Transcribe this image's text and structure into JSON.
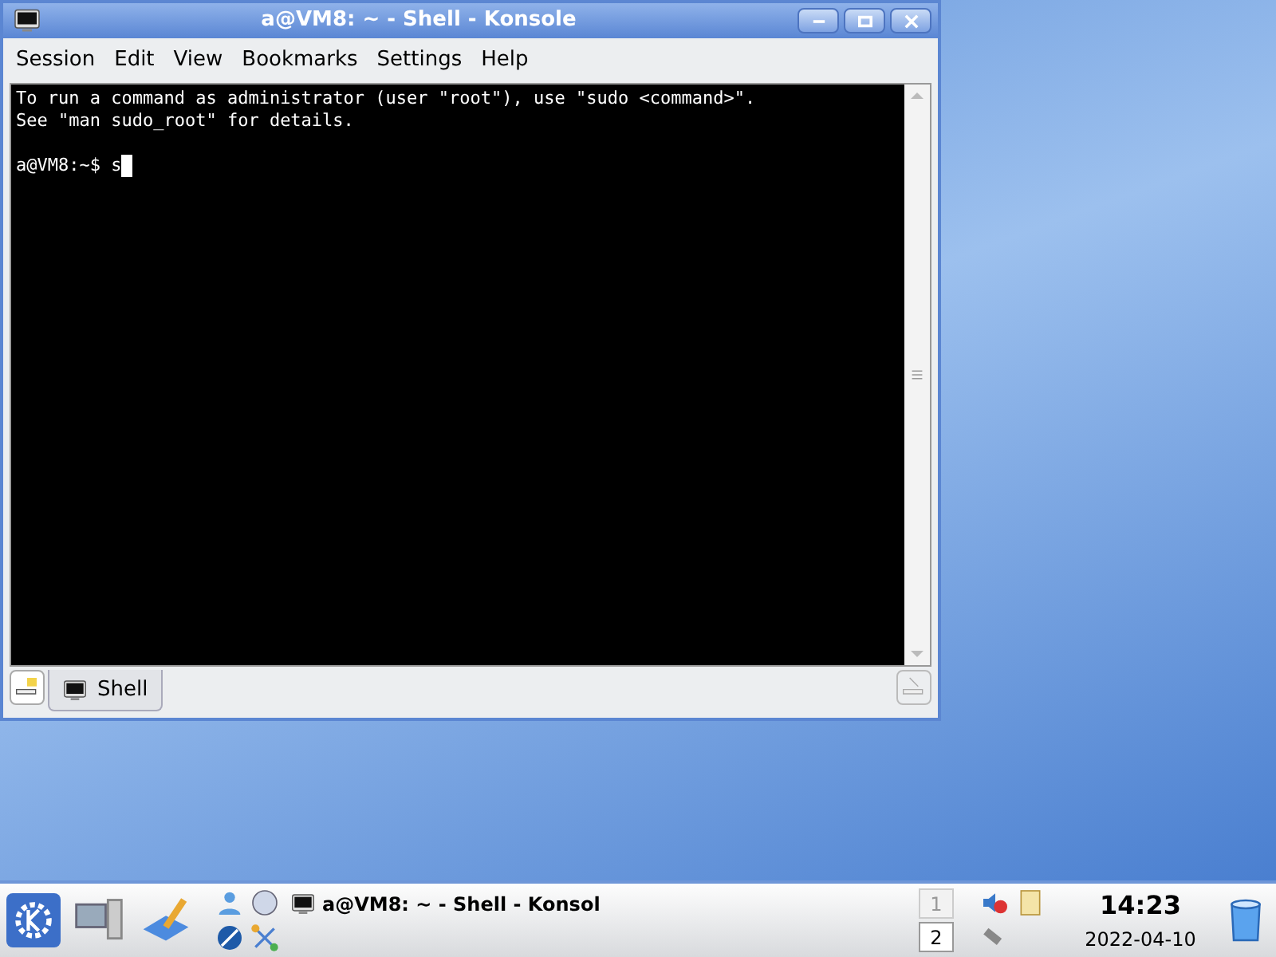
{
  "window": {
    "title": "a@VM8: ~ - Shell - Konsole"
  },
  "menu": [
    "Session",
    "Edit",
    "View",
    "Bookmarks",
    "Settings",
    "Help"
  ],
  "terminal": {
    "lines": [
      "To run a command as administrator (user \"root\"), use \"sudo <command>\".",
      "See \"man sudo_root\" for details."
    ],
    "prompt": "a@VM8:~$ ",
    "input": "s"
  },
  "tabs": [
    {
      "label": "Shell",
      "selected": true
    }
  ],
  "taskbar": {
    "task": "a@VM8: ~ - Shell - Konsol",
    "desktops": [
      {
        "label": "1",
        "selected": true
      },
      {
        "label": "2",
        "selected": false
      }
    ],
    "time": "14:23",
    "date": "2022-04-10"
  }
}
